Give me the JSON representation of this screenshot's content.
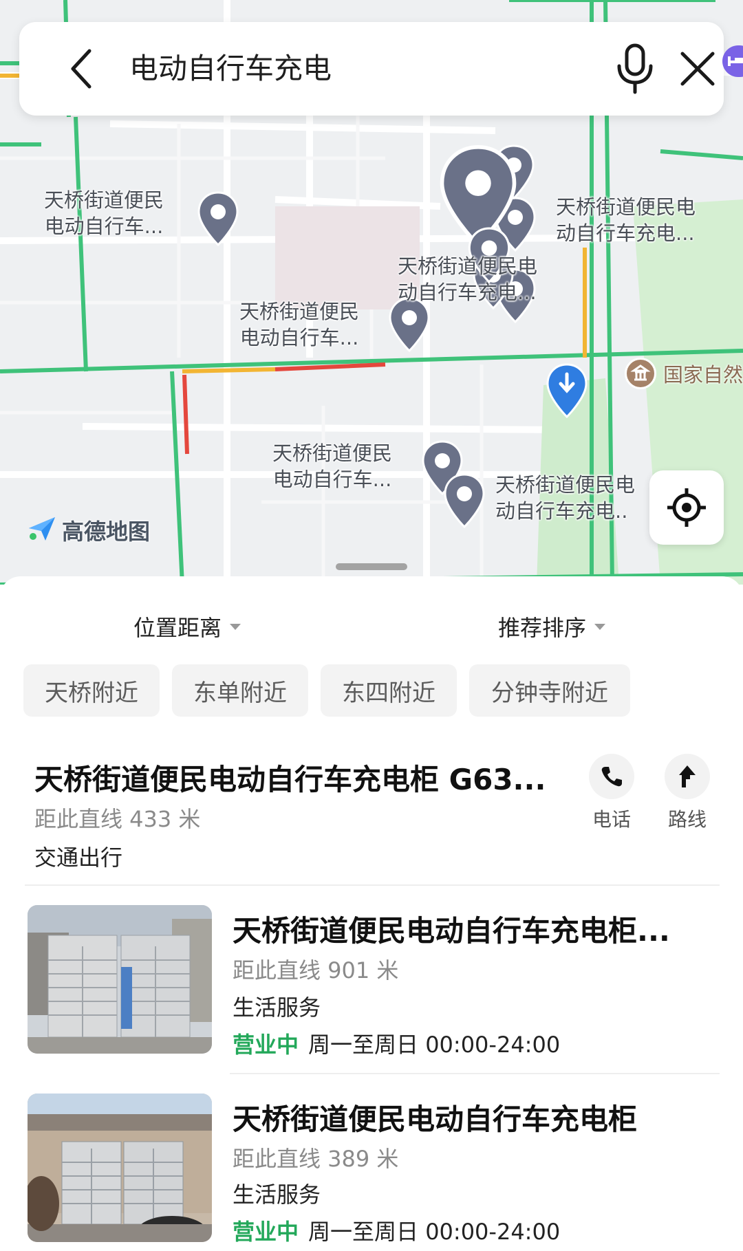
{
  "search": {
    "query": "电动自行车充电"
  },
  "map": {
    "attribution": "高德地图",
    "poi_label": "国家自然",
    "pin_labels": [
      [
        "天桥街道便民",
        "电动自行车..."
      ],
      [
        "天桥街道便民电",
        "动自行车充电..."
      ],
      [
        "天桥街道便民电",
        "动自行车充电..."
      ],
      [
        "天桥街道便民",
        "电动自行车..."
      ],
      [
        "天桥街道便民",
        "电动自行车..."
      ],
      [
        "天桥街道便民电",
        "动自行车充电.."
      ]
    ]
  },
  "filters": {
    "distance_label": "位置距离",
    "sort_label": "推荐排序",
    "chips": [
      "天桥附近",
      "东单附近",
      "东四附近",
      "分钟寺附近"
    ]
  },
  "results": [
    {
      "title": "天桥街道便民电动自行车充电柜 G63...",
      "distance": "距此直线 433 米",
      "category": "交通出行",
      "actions": {
        "call_label": "电话",
        "route_label": "路线"
      }
    },
    {
      "title": "天桥街道便民电动自行车充电柜...",
      "distance": "距此直线 901 米",
      "category": "生活服务",
      "status": "营业中",
      "hours": "周一至周日 00:00-24:00"
    },
    {
      "title": "天桥街道便民电动自行车充电柜",
      "distance": "距此直线 389 米",
      "category": "生活服务",
      "status": "营业中",
      "hours": "周一至周日 00:00-24:00"
    }
  ],
  "colors": {
    "pin": "#6a7188",
    "road_green": "#3fc27a",
    "road_yellow": "#f2b533",
    "road_red": "#e4473d",
    "location_marker": "#2f7de1",
    "open_status": "#23a85a"
  }
}
